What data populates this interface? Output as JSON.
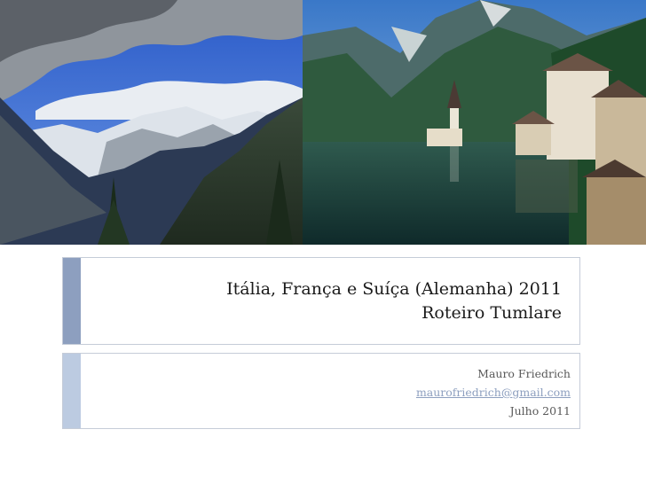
{
  "slide": {
    "title_line1": "Itália, França e Suíça (Alemanha) 2011",
    "title_line2": "Roteiro Tumlare",
    "author": "Mauro Friedrich",
    "email": "maurofriedrich@gmail.com",
    "date": "Julho 2011"
  },
  "colors": {
    "accent_dark": "#8d9fbf",
    "accent_light": "#bccbe1",
    "border": "#c5ccd8",
    "link": "#8d9fbf"
  }
}
